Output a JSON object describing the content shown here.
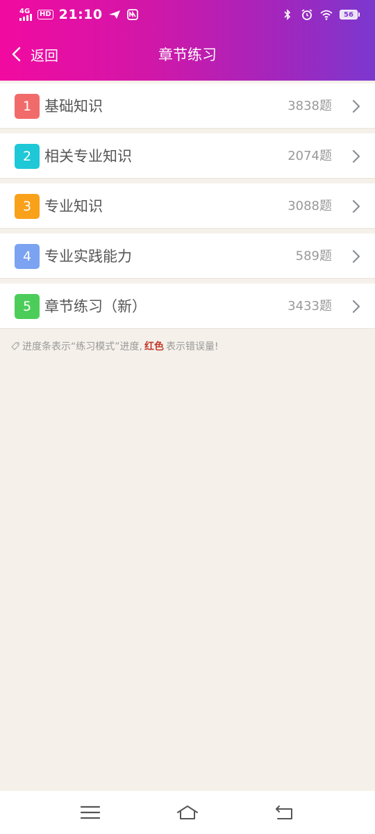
{
  "status_bar": {
    "network": "4G",
    "hd": "HD",
    "time": "21:10",
    "battery": "56"
  },
  "nav": {
    "back_label": "返回",
    "title": "章节练习"
  },
  "chapters": [
    {
      "index": "1",
      "name": "基础知识",
      "count": "3838题",
      "color": "#f26b6b"
    },
    {
      "index": "2",
      "name": "相关专业知识",
      "count": "2074题",
      "color": "#1ec8d6"
    },
    {
      "index": "3",
      "name": "专业知识",
      "count": "3088题",
      "color": "#f9a11b"
    },
    {
      "index": "4",
      "name": "专业实践能力",
      "count": "589题",
      "color": "#7ba3f2"
    },
    {
      "index": "5",
      "name": "章节练习（新）",
      "count": "3433题",
      "color": "#4ccd5a"
    }
  ],
  "hint": {
    "prefix": "进度条表示“练习模式”进度,",
    "red": "红色",
    "suffix": "表示错误量!"
  },
  "colors": {
    "header_start": "#f20aa0",
    "header_end": "#7b38cf",
    "background": "#f5f1ea"
  },
  "icons": {
    "back": "chevron-left-icon",
    "row_arrow": "chevron-right-icon",
    "menu": "menu-icon",
    "home": "home-icon",
    "return": "return-icon"
  }
}
